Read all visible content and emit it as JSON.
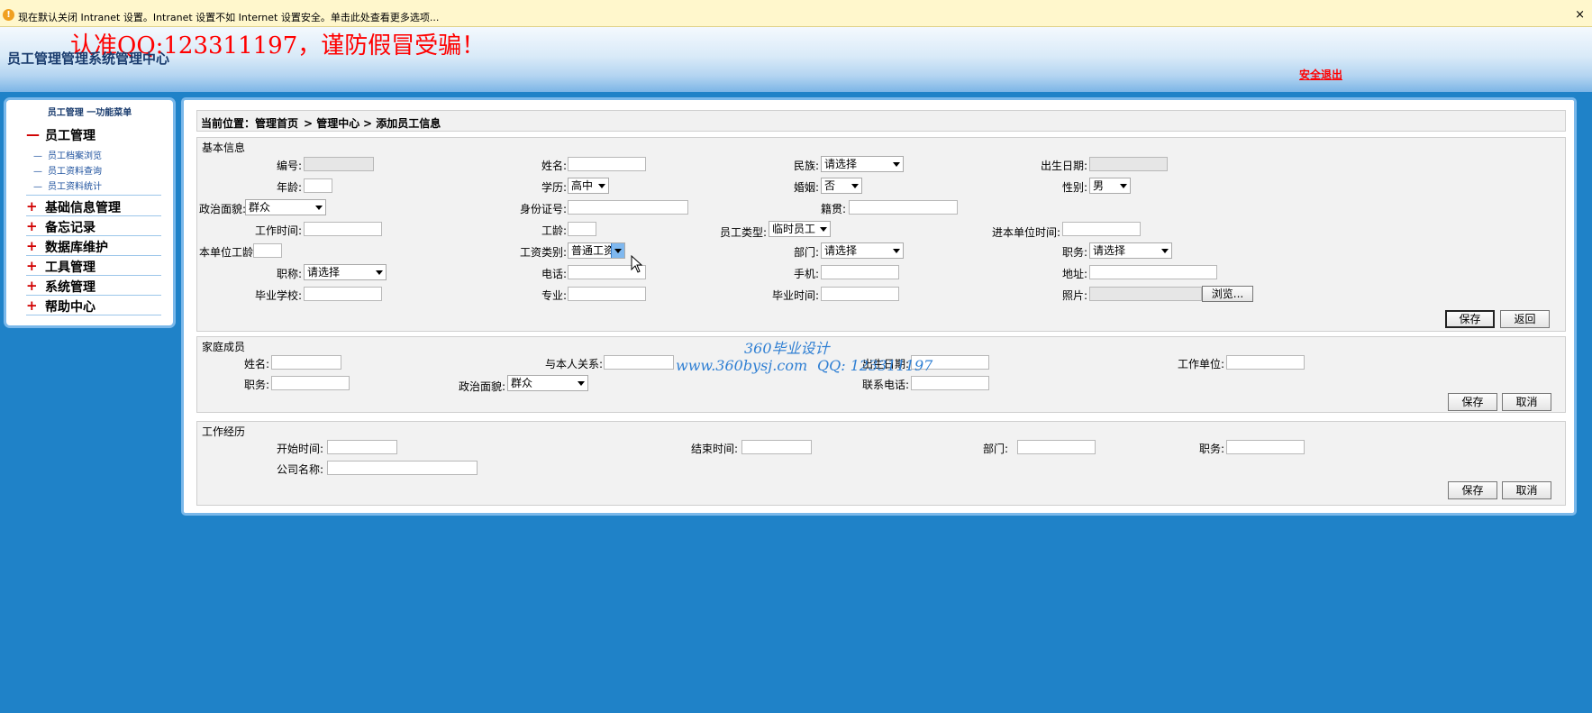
{
  "infobar": {
    "message": "现在默认关闭 Intranet 设置。Intranet 设置不如 Internet 设置安全。单击此处查看更多选项...",
    "close": "×"
  },
  "header": {
    "notice": "认准QQ:123311197，谨防假冒受骗！",
    "system_name": "员工管理管理系统管理中心",
    "logout": "安全退出"
  },
  "sidebar": {
    "title": "员工管理 一功能菜单",
    "groups": [
      {
        "sign": "—",
        "label": "员工管理"
      },
      {
        "sign": "+",
        "label": "基础信息管理"
      },
      {
        "sign": "+",
        "label": "备忘记录"
      },
      {
        "sign": "+",
        "label": "数据库维护"
      },
      {
        "sign": "+",
        "label": "工具管理"
      },
      {
        "sign": "+",
        "label": "系统管理"
      },
      {
        "sign": "+",
        "label": "帮助中心"
      }
    ],
    "sub_items": [
      "员工档案浏览",
      "员工资料查询",
      "员工资料统计"
    ]
  },
  "breadcrumb": {
    "prefix": "当前位置：",
    "home": "管理首页",
    "center": "> 管理中心",
    "current": "> 添加员工信息"
  },
  "basic": {
    "title": "基本信息",
    "labels": {
      "number": "编号:",
      "name": "姓名:",
      "nation": "民族:",
      "birth": "出生日期:",
      "age": "年龄:",
      "education": "学历:",
      "marriage": "婚姻:",
      "gender": "性别:",
      "politics": "政治面貌:",
      "idcard": "身份证号:",
      "origin": "籍贯:",
      "work_time": "工作时间:",
      "seniority": "工龄:",
      "emp_type": "员工类型:",
      "join_time": "进本单位时间:",
      "unit_seniority": "本单位工龄:",
      "salary_type": "工资类别:",
      "dept": "部门:",
      "position": "职务:",
      "title_rank": "职称:",
      "phone": "电话:",
      "mobile": "手机:",
      "address": "地址:",
      "school": "毕业学校:",
      "major": "专业:",
      "grad_time": "毕业时间:",
      "photo": "照片:"
    },
    "values": {
      "nation": "请选择",
      "education": "高中",
      "marriage": "否",
      "gender": "男",
      "politics": "群众",
      "emp_type": "临时员工",
      "salary_type": "普通工资",
      "dept": "请选择",
      "position": "请选择",
      "title_rank": "请选择"
    },
    "browse": "浏览...",
    "save": "保存",
    "back": "返回"
  },
  "family": {
    "title": "家庭成员",
    "labels": {
      "name": "姓名:",
      "relation": "与本人关系:",
      "birth": "出生日期:",
      "workplace": "工作单位:",
      "position": "职务:",
      "politics": "政治面貌:",
      "phone": "联系电话:"
    },
    "values": {
      "politics": "群众"
    },
    "save": "保存",
    "cancel": "取消"
  },
  "experience": {
    "title": "工作经历",
    "labels": {
      "start": "开始时间:",
      "end": "结束时间:",
      "dept": "部门:",
      "position": "职务:",
      "company": "公司名称:"
    },
    "save": "保存",
    "cancel": "取消"
  },
  "watermark": {
    "line1": "360毕业设计",
    "site": "www.360bysj.com",
    "qq": "QQ:  123311197"
  }
}
